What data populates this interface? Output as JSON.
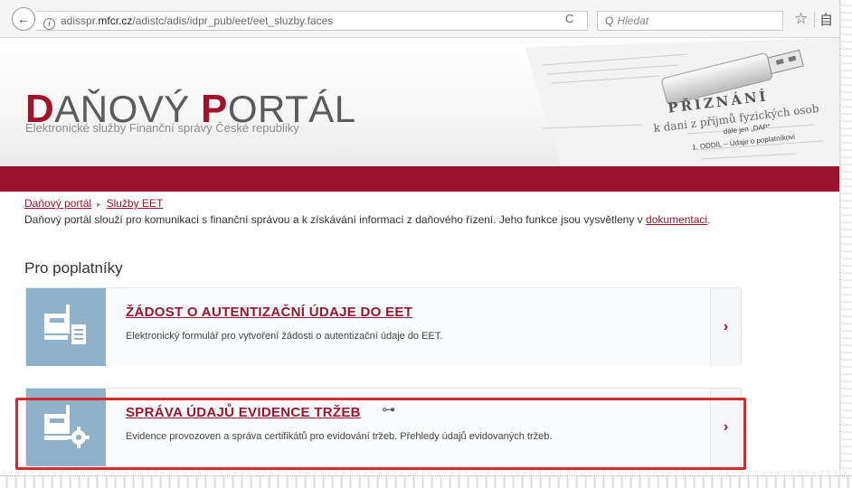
{
  "browser": {
    "back_glyph": "←",
    "info_glyph": "i",
    "url_prefix": "adisspr.",
    "url_host": "mfcr.cz",
    "url_path": "/adistc/adis/idpr_pub/eet/eet_sluzby.faces",
    "reload_glyph": "C",
    "search_placeholder": "Hledat",
    "search_glyph": "Q",
    "star_glyph": "☆",
    "reader_glyph": "自"
  },
  "header": {
    "logo_d": "D",
    "logo_mid1": "AŇOVÝ ",
    "logo_p": "P",
    "logo_mid2": "ORTÁL",
    "subtitle": "Elektronické služby Finanční správy České republiky",
    "banner_doc_title": "PŘIZNÁNÍ",
    "banner_doc_sub": "k dani z příjmů fyzických osob",
    "banner_line_1": "1. ODDÍL – Údaje o poplatníkovi",
    "banner_line_2": "dále jen „DAP“"
  },
  "breadcrumb": {
    "items": [
      "Daňový portál",
      "Služby EET"
    ],
    "separator": "▸"
  },
  "intro": {
    "text": "Daňový portál slouží pro komunikaci s finanční správou a k získávání informací z daňového řízení. Jeho funkce jsou vysvětleny v ",
    "link": "dokumentaci",
    "end": "."
  },
  "section": {
    "heading": "Pro poplatníky"
  },
  "cards": [
    {
      "title": "ŽÁDOST O AUTENTIZAČNÍ ÚDAJE DO EET",
      "description": "Elektronický formulář pro vytvoření žádosti o autentizační údaje do EET.",
      "arrow": "›"
    },
    {
      "title": "SPRÁVA ÚDAJŮ EVIDENCE TRŽEB",
      "key_glyph": "⊶",
      "description": "Evidence provozoven a správa certifikátů pro evidování tržeb. Přehledy údajů evidovaných tržeb.",
      "arrow": "›"
    }
  ],
  "colors": {
    "brand_red": "#9c1530",
    "icon_blue": "#8fb1c9",
    "highlight": "#d42a2a"
  }
}
